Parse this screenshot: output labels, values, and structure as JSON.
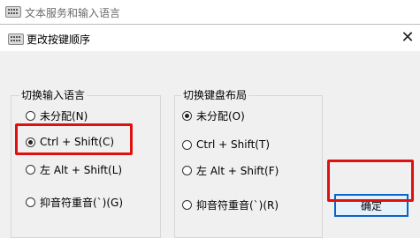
{
  "parent_window": {
    "title": "文本服务和输入语言"
  },
  "dialog": {
    "title": "更改按键顺序",
    "close_symbol": "✕",
    "input_language_group": {
      "label": "切换输入语言",
      "options": [
        {
          "label": "未分配(N)",
          "selected": false
        },
        {
          "label": "Ctrl + Shift(C)",
          "selected": true
        },
        {
          "label": "左 Alt + Shift(L)",
          "selected": false
        },
        {
          "label": "抑音符重音(`)(G)",
          "selected": false
        }
      ]
    },
    "keyboard_layout_group": {
      "label": "切换键盘布局",
      "options": [
        {
          "label": "未分配(O)",
          "selected": true
        },
        {
          "label": "Ctrl + Shift(T)",
          "selected": false
        },
        {
          "label": "左 Alt + Shift(F)",
          "selected": false
        },
        {
          "label": "抑音符重音(`)(R)",
          "selected": false
        }
      ]
    },
    "ok_label": "确定"
  },
  "colors": {
    "highlight": "#e01010",
    "button_focus_border": "#0a64c8"
  }
}
